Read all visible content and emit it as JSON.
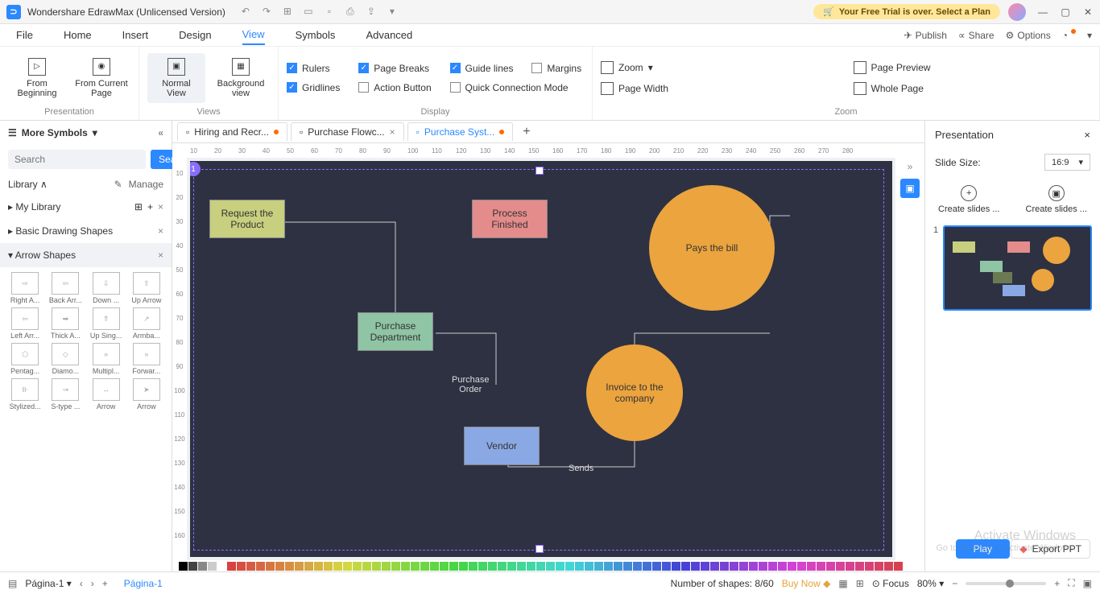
{
  "app": {
    "title": "Wondershare EdrawMax (Unlicensed Version)",
    "trial_text": "Your Free Trial is over. Select a Plan"
  },
  "menu": {
    "items": [
      "File",
      "Home",
      "Insert",
      "Design",
      "View",
      "Symbols",
      "Advanced"
    ],
    "active": 4,
    "right": {
      "publish": "Publish",
      "share": "Share",
      "options": "Options"
    }
  },
  "ribbon": {
    "presentation": {
      "label": "Presentation",
      "from_beginning": "From\nBeginning",
      "from_current": "From Current\nPage"
    },
    "views": {
      "label": "Views",
      "normal": "Normal\nView",
      "background": "Background\nview"
    },
    "display": {
      "label": "Display",
      "rulers": "Rulers",
      "page_breaks": "Page Breaks",
      "guide_lines": "Guide lines",
      "margins": "Margins",
      "gridlines": "Gridlines",
      "action_button": "Action Button",
      "quick_conn": "Quick Connection Mode"
    },
    "zoom": {
      "label": "Zoom",
      "zoom": "Zoom",
      "page_preview": "Page Preview",
      "page_width": "Page Width",
      "whole_page": "Whole Page"
    }
  },
  "left": {
    "more_symbols": "More Symbols",
    "search_placeholder": "Search",
    "search_btn": "Search",
    "library": "Library",
    "manage": "Manage",
    "sections": [
      {
        "name": "My Library"
      },
      {
        "name": "Basic Drawing Shapes"
      },
      {
        "name": "Arrow Shapes",
        "active": true
      }
    ],
    "shapes": [
      "Right A...",
      "Back Arr...",
      "Down ...",
      "Up Arrow",
      "Left Arr...",
      "Thick A...",
      "Up Sing...",
      "Armba...",
      "Pentag...",
      "Diamo...",
      "Multipl...",
      "Forwar...",
      "Stylized...",
      "S-type ...",
      "Arrow",
      "Arrow"
    ]
  },
  "tabs": [
    {
      "label": "Hiring and Recr...",
      "dirty": true
    },
    {
      "label": "Purchase Flowc...",
      "dirty": false
    },
    {
      "label": "Purchase Syst...",
      "dirty": true,
      "active": true
    }
  ],
  "diagram": {
    "nodes": {
      "request": "Request the\nProduct",
      "process": "Process\nFinished",
      "pays": "Pays the bill",
      "purchase": "Purchase\nDepartment",
      "invoice": "Invoice to the\ncompany",
      "vendor": "Vendor"
    },
    "labels": {
      "po": "Purchase\nOrder",
      "sends": "Sends"
    }
  },
  "right": {
    "title": "Presentation",
    "slide_size_label": "Slide Size:",
    "slide_size_value": "16:9",
    "create1": "Create slides ...",
    "create2": "Create slides ...",
    "thumb_num": "1",
    "play": "Play",
    "export": "Export PPT"
  },
  "status": {
    "page_select": "Página-1",
    "page_tab": "Página-1",
    "shapes": "Number of shapes: 8/60",
    "buy": "Buy Now",
    "focus": "Focus",
    "zoom": "80%"
  },
  "watermark": {
    "l1": "Activate Windows",
    "l2": "Go to Settings to activate Windows."
  }
}
